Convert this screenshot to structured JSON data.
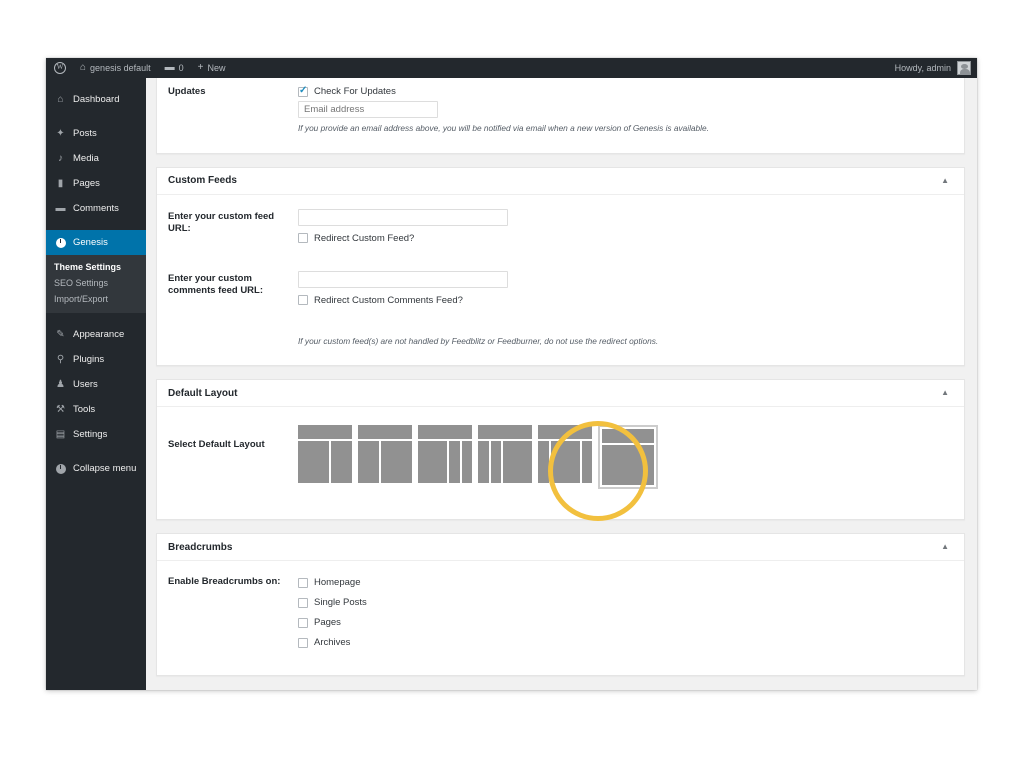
{
  "adminbar": {
    "logo_icon": "wordpress-logo-icon",
    "site_name": "genesis default",
    "home_icon": "home-icon",
    "comments_icon": "comment-bubble-icon",
    "comments_count": "0",
    "new_icon": "plus-icon",
    "new_label": "New",
    "howdy": "Howdy, admin"
  },
  "sidebar": {
    "items": [
      {
        "label": "Dashboard",
        "icon": "dashboard-icon",
        "active": false
      },
      {
        "label": "Posts",
        "icon": "pin-icon",
        "active": false
      },
      {
        "label": "Media",
        "icon": "media-icon",
        "active": false
      },
      {
        "label": "Pages",
        "icon": "page-icon",
        "active": false
      },
      {
        "label": "Comments",
        "icon": "comment-bubble-icon",
        "active": false
      },
      {
        "label": "Genesis",
        "icon": "genesis-icon",
        "active": true
      },
      {
        "label": "Appearance",
        "icon": "brush-icon",
        "active": false
      },
      {
        "label": "Plugins",
        "icon": "plug-icon",
        "active": false
      },
      {
        "label": "Users",
        "icon": "users-icon",
        "active": false
      },
      {
        "label": "Tools",
        "icon": "wrench-icon",
        "active": false
      },
      {
        "label": "Settings",
        "icon": "sliders-icon",
        "active": false
      },
      {
        "label": "Collapse menu",
        "icon": "collapse-icon",
        "active": false
      }
    ],
    "genesis_submenu": [
      {
        "label": "Theme Settings",
        "current": true
      },
      {
        "label": "SEO Settings",
        "current": false
      },
      {
        "label": "Import/Export",
        "current": false
      }
    ]
  },
  "updates": {
    "label": "Updates",
    "checkbox_label": "Check For Updates",
    "checkbox_checked": true,
    "email_value": "",
    "email_placeholder": "Email address",
    "hint": "If you provide an email address above, you will be notified via email when a new version of Genesis is available."
  },
  "custom_feeds": {
    "title": "Custom Feeds",
    "toggle_icon": "chevron-up-icon",
    "feed_url_label": "Enter your custom feed URL:",
    "feed_url_value": "",
    "feed_redirect_label": "Redirect Custom Feed?",
    "feed_redirect_checked": false,
    "comments_url_label": "Enter your custom comments feed URL:",
    "comments_url_value": "",
    "comments_redirect_label": "Redirect Custom Comments Feed?",
    "comments_redirect_checked": false,
    "hint": "If your custom feed(s) are not handled by Feedblitz or Feedburner, do not use the redirect options."
  },
  "default_layout": {
    "title": "Default Layout",
    "toggle_icon": "chevron-up-icon",
    "select_label": "Select Default Layout",
    "options": [
      {
        "name": "content-sidebar",
        "columns": [
          60,
          40
        ],
        "selected": false
      },
      {
        "name": "sidebar-content",
        "columns": [
          40,
          60
        ],
        "selected": false
      },
      {
        "name": "content-sidebar-sidebar",
        "columns": [
          58,
          21,
          21
        ],
        "selected": false
      },
      {
        "name": "sidebar-sidebar-content",
        "columns": [
          21,
          21,
          58
        ],
        "selected": false
      },
      {
        "name": "sidebar-content-sidebar",
        "columns": [
          21,
          58,
          21
        ],
        "selected": false
      },
      {
        "name": "full-width-content",
        "columns": [
          100
        ],
        "selected": true
      }
    ],
    "highlight_color": "#f2c03e"
  },
  "breadcrumbs": {
    "title": "Breadcrumbs",
    "toggle_icon": "chevron-up-icon",
    "enable_label": "Enable Breadcrumbs on:",
    "options": [
      {
        "label": "Homepage",
        "checked": false
      },
      {
        "label": "Single Posts",
        "checked": false
      },
      {
        "label": "Pages",
        "checked": false
      },
      {
        "label": "Archives",
        "checked": false
      }
    ]
  }
}
